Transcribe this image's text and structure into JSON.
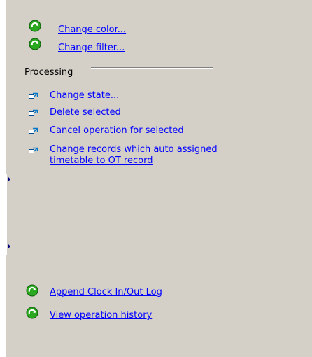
{
  "top_actions": {
    "change_color": "Change color...",
    "change_filter": "Change filter..."
  },
  "processing": {
    "title": "Processing",
    "items": [
      "Change state...",
      "Delete selected",
      "Cancel operation for selected",
      "Change records which auto assigned timetable to OT record"
    ]
  },
  "bottom_actions": {
    "append_log": "Append Clock In/Out Log",
    "view_history": "View operation history"
  },
  "icons": {
    "go": "green-refresh-arrow-icon",
    "small": "blue-arrow-link-icon"
  },
  "colors": {
    "panel_bg": "#d4d0c8",
    "link": "#0000ff",
    "go_green": "#2aa81f"
  }
}
